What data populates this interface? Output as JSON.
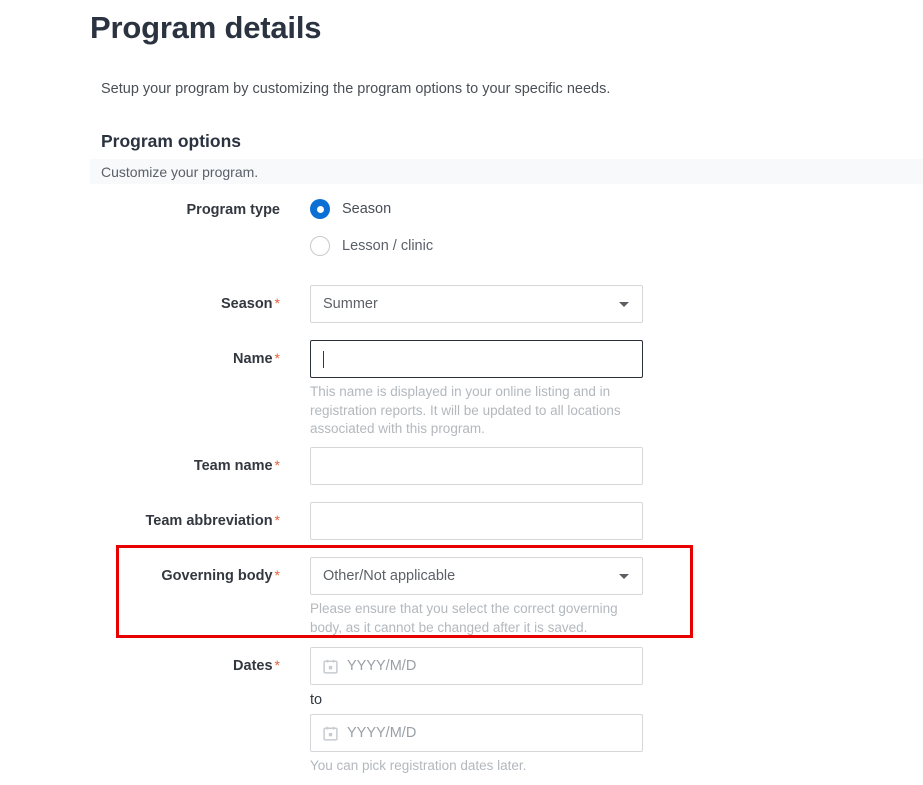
{
  "header": {
    "title": "Program details",
    "subtitle": "Setup your program by customizing the program options to your specific needs."
  },
  "section": {
    "title": "Program options",
    "band_label": "Customize your program."
  },
  "required_marker": "*",
  "form": {
    "program_type": {
      "label": "Program type",
      "options": [
        {
          "label": "Season",
          "selected": true
        },
        {
          "label": "Lesson / clinic",
          "selected": false
        }
      ]
    },
    "season": {
      "label": "Season",
      "required": true,
      "value": "Summer",
      "control": "select"
    },
    "name": {
      "label": "Name",
      "required": true,
      "value": "",
      "focused": true,
      "hint": "This name is displayed in your online listing and in registration reports. It will be updated to all locations associated with this program."
    },
    "team_name": {
      "label": "Team name",
      "required": true,
      "value": ""
    },
    "team_abbreviation": {
      "label": "Team abbreviation",
      "required": true,
      "value": ""
    },
    "governing_body": {
      "label": "Governing body",
      "required": true,
      "value": "Other/Not applicable",
      "control": "select",
      "hint": "Please ensure that you select the correct governing body, as it cannot be changed after it is saved."
    },
    "dates": {
      "label": "Dates",
      "required": true,
      "start_placeholder": "YYYY/M/D",
      "separator": "to",
      "end_placeholder": "YYYY/M/D",
      "hint": "You can pick registration dates later."
    }
  },
  "colors": {
    "accent_blue": "#0b6fd4",
    "required_asterisk": "#e8603c",
    "annotation_red": "#e60000",
    "band_gray": "#f8f9fa"
  }
}
